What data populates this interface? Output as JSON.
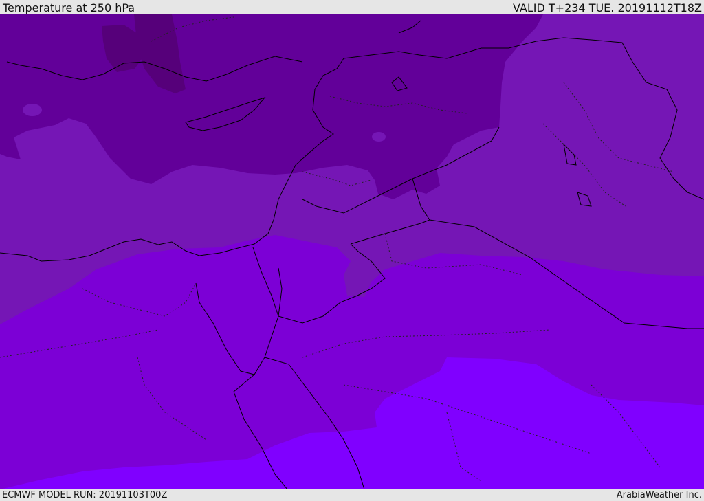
{
  "header": {
    "title": "Temperature at 250 hPa",
    "valid": "VALID T+234 TUE. 20191112T18Z"
  },
  "footer": {
    "model_run": "ECMWF MODEL RUN: 20191103T00Z",
    "credit": "ArabiaWeather Inc."
  },
  "map": {
    "field": "temperature",
    "level": "250 hPa",
    "colors": {
      "coldest": "#56007a",
      "band1": "#620099",
      "band2": "#7516b5",
      "band3": "#7c00d6",
      "band4": "#8000ff",
      "border": "#000000"
    }
  }
}
